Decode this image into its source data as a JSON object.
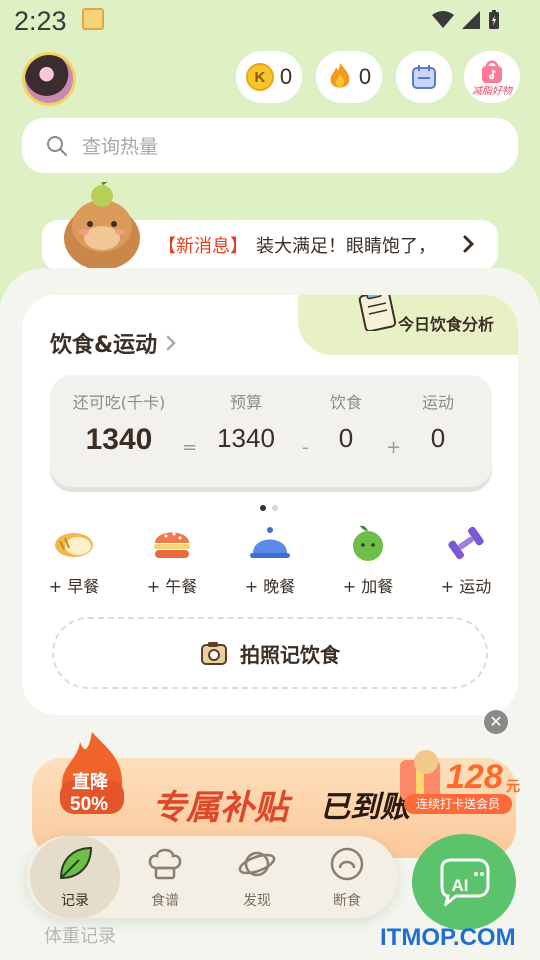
{
  "status_bar": {
    "time": "2:23"
  },
  "header": {
    "coins": "0",
    "streak": "0",
    "coin_symbol": "K",
    "shop_label": "减脂好物"
  },
  "search": {
    "placeholder": "查询热量"
  },
  "news": {
    "tag": "【新消息】",
    "text": "装大满足！眼睛饱了，"
  },
  "diet_card": {
    "title": "饮食&运动",
    "analysis_label": "今日饮食分析",
    "remaining_label": "还可吃(千卡)",
    "remaining_value": "1340",
    "budget_label": "预算",
    "budget_value": "1340",
    "food_label": "饮食",
    "food_value": "0",
    "exercise_label": "运动",
    "exercise_value": "0",
    "op_equals": "=",
    "op_minus": "-",
    "op_plus": "+"
  },
  "meals": [
    {
      "label": "+ 早餐",
      "icon": "bread-icon"
    },
    {
      "label": "+ 午餐",
      "icon": "burger-icon"
    },
    {
      "label": "+ 晚餐",
      "icon": "cloche-icon"
    },
    {
      "label": "+ 加餐",
      "icon": "apple-icon"
    },
    {
      "label": "+ 运动",
      "icon": "dumbbell-icon"
    }
  ],
  "photo_button": {
    "label": "拍照记饮食"
  },
  "promo": {
    "discount_top": "直降",
    "discount_value": "50%",
    "title_left": "专属补贴",
    "title_right": "已到账",
    "price": "128",
    "price_unit": "元",
    "price_sub": "连续打卡送会员"
  },
  "bottom_nav": {
    "items": [
      {
        "label": "记录"
      },
      {
        "label": "食谱"
      },
      {
        "label": "发现"
      },
      {
        "label": "断食"
      }
    ],
    "ai_label": "AI"
  },
  "footer": {
    "weight_record": "体重记录",
    "watermark": "ITMOP.COM"
  }
}
